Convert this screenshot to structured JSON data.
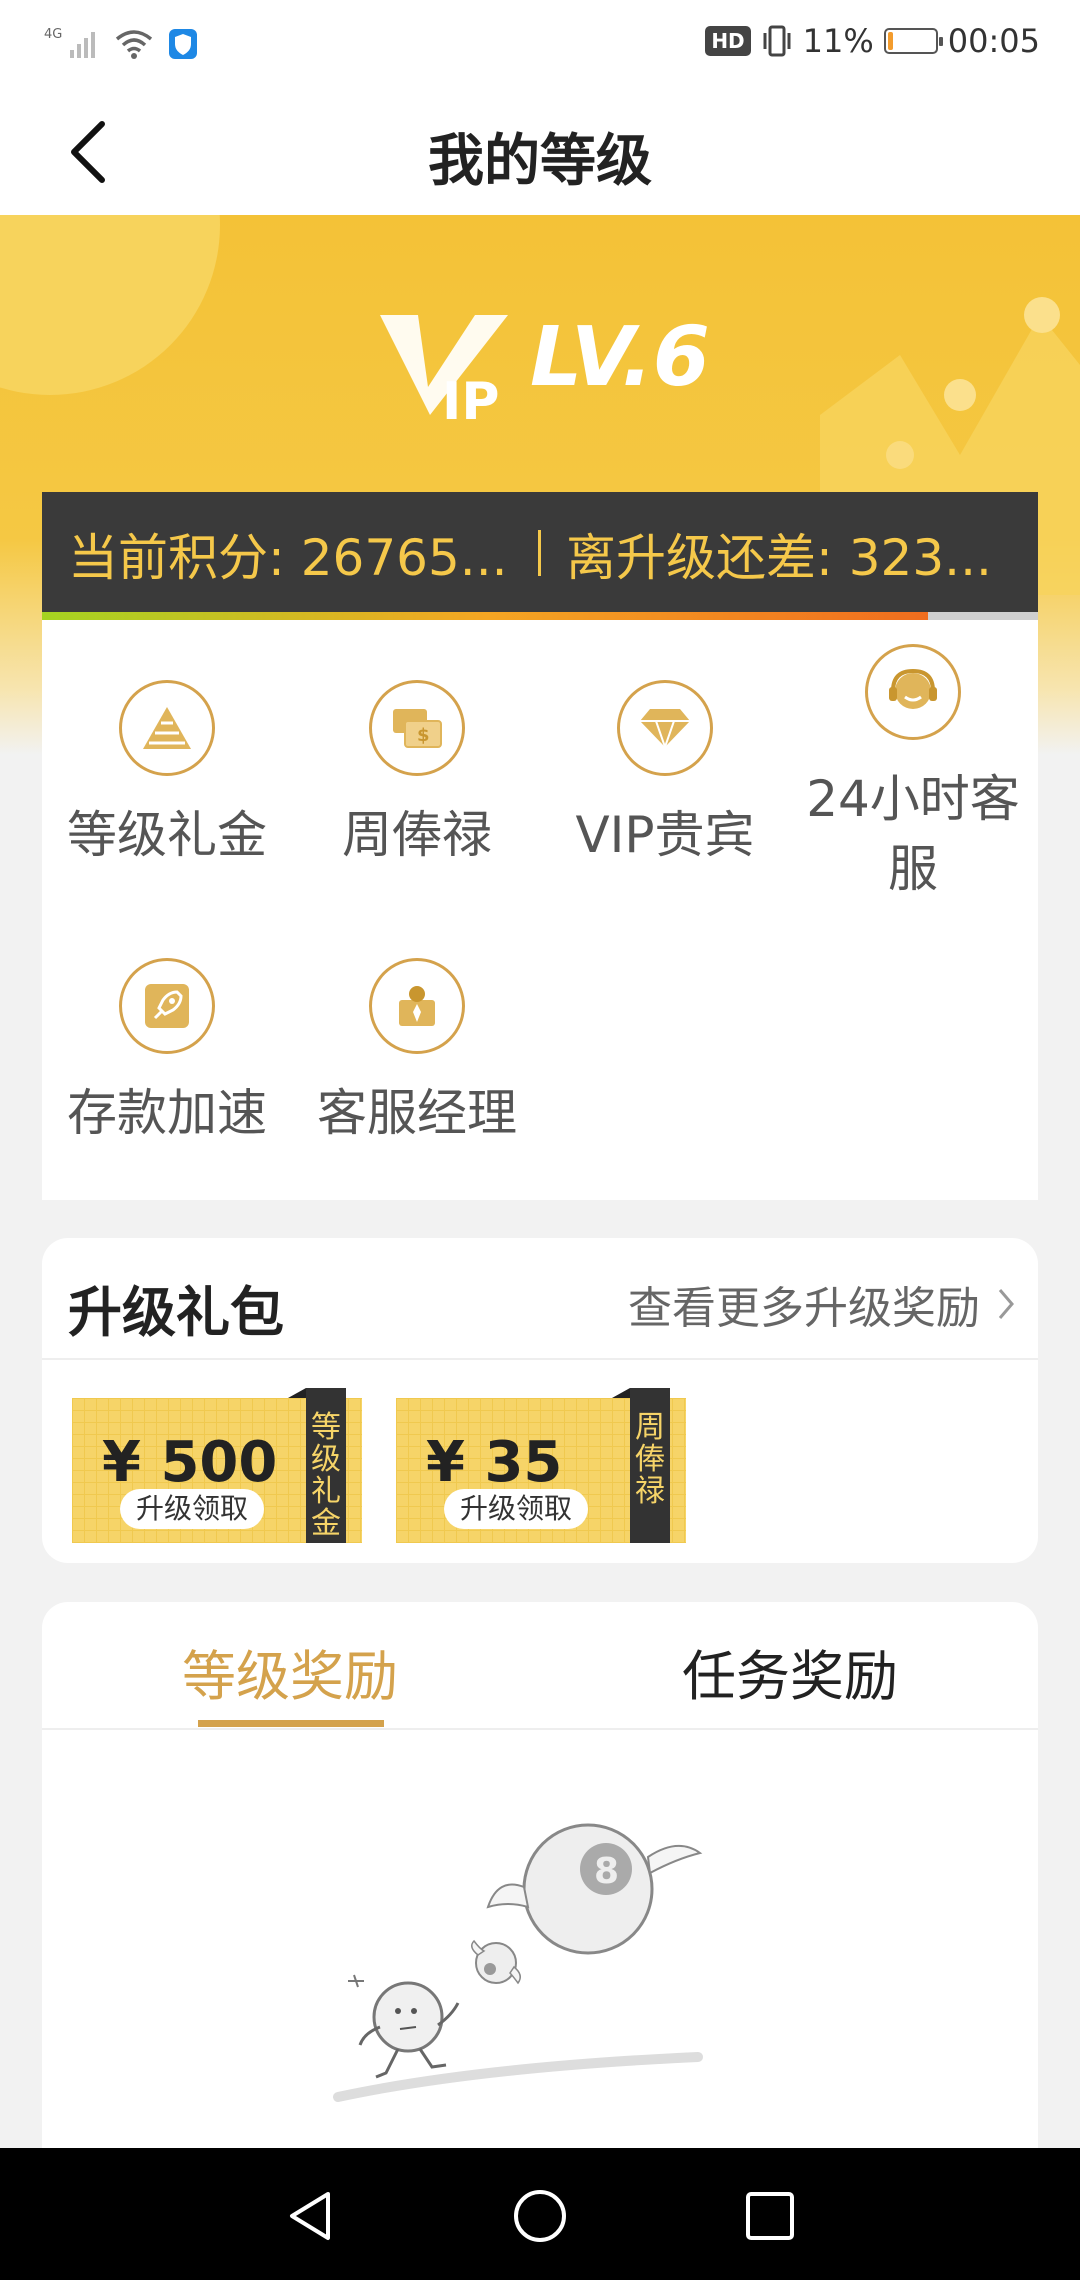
{
  "status": {
    "network": "4G",
    "hd": "HD",
    "battery_text": "11%",
    "battery_level": 0.11,
    "time": "00:05"
  },
  "header": {
    "title": "我的等级"
  },
  "hero": {
    "vip_text": "V",
    "vip_ip": "IP",
    "level": "LV.6"
  },
  "score": {
    "current": "当前积分: 26765...",
    "remaining": "离升级还差: 323...",
    "progress": 0.89
  },
  "benefits": [
    {
      "label": "等级礼金",
      "icon": "pyramid-icon"
    },
    {
      "label": "周俸禄",
      "icon": "money-card-icon"
    },
    {
      "label": "VIP贵宾",
      "icon": "diamond-icon"
    },
    {
      "label": "24小时客服",
      "icon": "headset-icon"
    },
    {
      "label": "存款加速",
      "icon": "rocket-icon"
    },
    {
      "label": "客服经理",
      "icon": "manager-icon"
    }
  ],
  "gift": {
    "title": "升级礼包",
    "more": "查看更多升级奖励",
    "coupons": [
      {
        "amount": "¥ 500",
        "chip": "升级领取",
        "side": "等级礼金"
      },
      {
        "amount": "¥ 35",
        "chip": "升级领取",
        "side": "周俸禄"
      }
    ]
  },
  "rewards": {
    "tabs": [
      "等级奖励",
      "任务奖励"
    ],
    "active_tab": 0
  },
  "colors": {
    "accent": "#d4a24c",
    "hero": "#f4c237",
    "score_bg": "#3a3a3a",
    "score_text": "#f5c84a"
  }
}
